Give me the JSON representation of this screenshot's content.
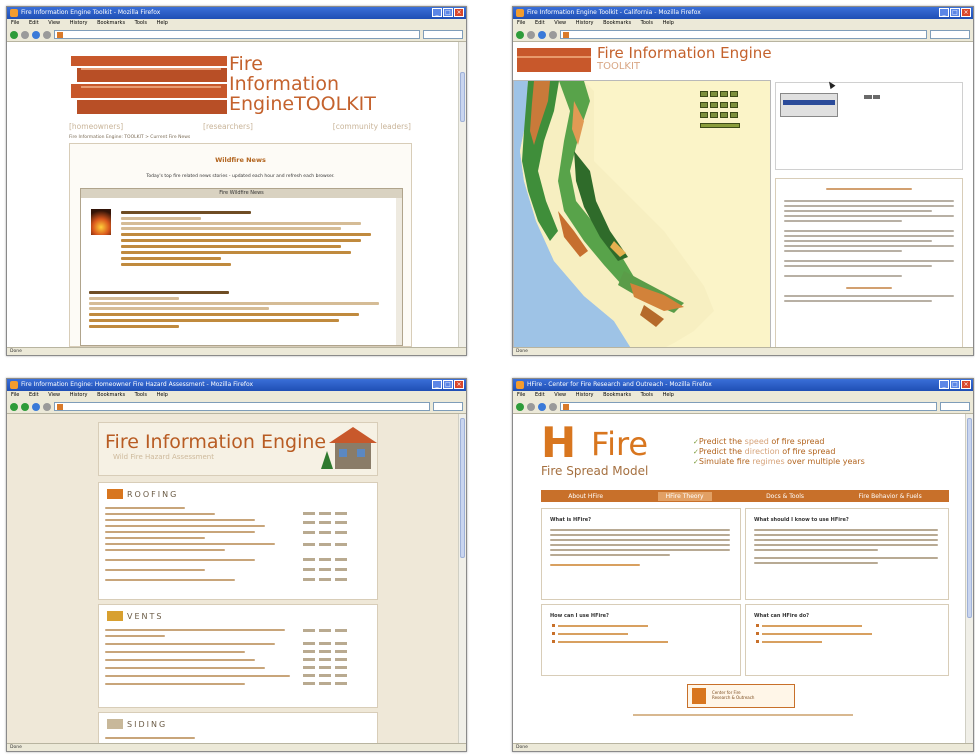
{
  "browser": {
    "menu": [
      "File",
      "Edit",
      "View",
      "History",
      "Bookmarks",
      "Tools",
      "Help"
    ]
  },
  "screens": {
    "fie_toolkit": {
      "window_title": "Fire Information Engine Toolkit - Mozilla Firefox",
      "logo_line1": "Fire",
      "logo_line2": "Information",
      "logo_line3": "Engine",
      "logo_toolkit": "TOOLKIT",
      "nav": [
        "[homeowners]",
        "[researchers]",
        "[community leaders]"
      ],
      "breadcrumb": "Fire Information Engine: TOOLKIT > Current Fire News",
      "section_title": "Wildfire News",
      "intro": "Today's top fire related news stories - updated each hour and refresh each browser.",
      "feed_header": "Fire Wildfire News",
      "status": "Done"
    },
    "fie_map": {
      "window_title": "Fire Information Engine Toolkit - California - Mozilla Firefox",
      "title": "Fire Information Engine",
      "subtitle": "TOOLKIT",
      "status": "Done"
    },
    "fie_assessment": {
      "window_title": "Fire Information Engine: Homeowner Fire Hazard Assessment - Mozilla Firefox",
      "title": "Fire Information Engine",
      "subtitle": "Wild Fire Hazard Assessment",
      "sections": [
        "ROOFING",
        "VENTS",
        "SIDING"
      ],
      "status": "Done"
    },
    "hfire": {
      "window_title": "HFire - Center for Fire Research and Outreach - Mozilla Firefox",
      "logo_h": "H",
      "logo_fire": "Fire",
      "logo_sub": "Fire Spread Model",
      "bullets": [
        {
          "pre": "Predict the ",
          "em": "speed",
          "post": " of fire spread"
        },
        {
          "pre": "Predict the ",
          "em": "direction",
          "post": " of fire spread"
        },
        {
          "pre": "Simulate fire ",
          "em": "regimes",
          "post": " over multiple years"
        }
      ],
      "nav": [
        "About HFire",
        "HFire Theory",
        "Docs & Tools",
        "Fire Behavior & Fuels"
      ],
      "boxes": [
        "What is HFire?",
        "What should I know to use HFire?",
        "How can I use HFire?",
        "What can HFire do?"
      ],
      "footer_logo_text": [
        "Center for Fire",
        "Research & Outreach"
      ],
      "status": "Done"
    }
  },
  "colors": {
    "brand_orange": "#c8582b",
    "title_orange": "#c4622d",
    "hfire_orange": "#d8761f",
    "firefox_blue": "#1f4fb4"
  }
}
